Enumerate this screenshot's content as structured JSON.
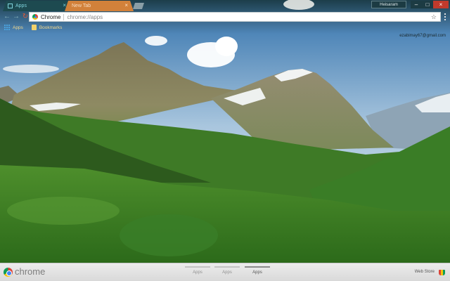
{
  "tabs": [
    {
      "label": "Apps",
      "active": true
    },
    {
      "label": "New Tab",
      "active": false
    }
  ],
  "profile": {
    "name": "Heisaram"
  },
  "toolbar": {
    "omnibox_chrome_label": "Chrome",
    "url": "chrome://apps"
  },
  "bookmarks": [
    {
      "label": "Apps",
      "icon": "apps-grid-icon"
    },
    {
      "label": "Bookmarks",
      "icon": "folder-icon"
    }
  ],
  "account": {
    "email": "ezabimay67@gmail.com"
  },
  "footer": {
    "logo_text": "chrome",
    "page_tabs": [
      {
        "label": "Apps",
        "active": false
      },
      {
        "label": "Apps",
        "active": false
      },
      {
        "label": "Apps",
        "active": true
      }
    ],
    "webstore_label": "Web Store"
  },
  "colors": {
    "frame": "#16343a",
    "active_tab": "#1d4a50",
    "inactive_tab": "#d2813a",
    "close_button": "#c13a2c",
    "bookmark_text": "#f3d88a"
  }
}
